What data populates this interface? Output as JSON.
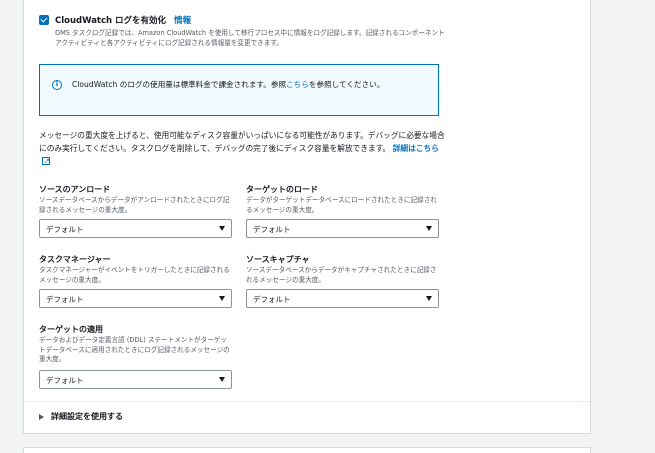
{
  "logging": {
    "checkbox_label": "CloudWatch ログを有効化",
    "info_link": "情報",
    "description": "DMS タスクログ記録では、Amazon CloudWatch を使用して移行プロセス中に情報をログ記録します。記録されるコンポーネントアクティビティと各アクティビティにログ記録される情報量を変更できます。"
  },
  "info_alert": {
    "text_before": "CloudWatch のログの使用量は標準料金で課金されます。参照",
    "link": "こちら",
    "text_after": "を参照してください。"
  },
  "warning": {
    "text": "メッセージの重大度を上げると、使用可能なディスク容量がいっぱいになる可能性があります。デバッグに必要な場合にのみ実行してください。タスクログを削除して、デバッグの完了後にディスク容量を解放できます。",
    "link": "詳細はこちら"
  },
  "fields": {
    "source_unload": {
      "label": "ソースのアンロード",
      "description": "ソースデータベースからデータがアンロードされたときにログ記録されるメッセージの重大度。",
      "value": "デフォルト"
    },
    "target_load": {
      "label": "ターゲットのロード",
      "description": "データがターゲットデータベースにロードされたときに記録されるメッセージの重大度。",
      "value": "デフォルト"
    },
    "task_manager": {
      "label": "タスクマネージャー",
      "description": "タスクマネージャーがイベントをトリガーしたときに記録されるメッセージの重大度。",
      "value": "デフォルト"
    },
    "source_capture": {
      "label": "ソースキャプチャ",
      "description": "ソースデータベースからデータがキャプチャされたときに記録されるメッセージの重大度。",
      "value": "デフォルト"
    },
    "target_apply": {
      "label": "ターゲットの適用",
      "description": "データおよびデータ定義言語 (DDL) ステートメントがターゲットデータベースに適用されたときにログ記録されるメッセージの重大度。",
      "value": "デフォルト"
    }
  },
  "advanced": {
    "label": "詳細設定を使用する"
  },
  "colors": {
    "accent": "#0073bb",
    "info_bg": "#f1faff",
    "page_bg": "#f2f3f3"
  }
}
